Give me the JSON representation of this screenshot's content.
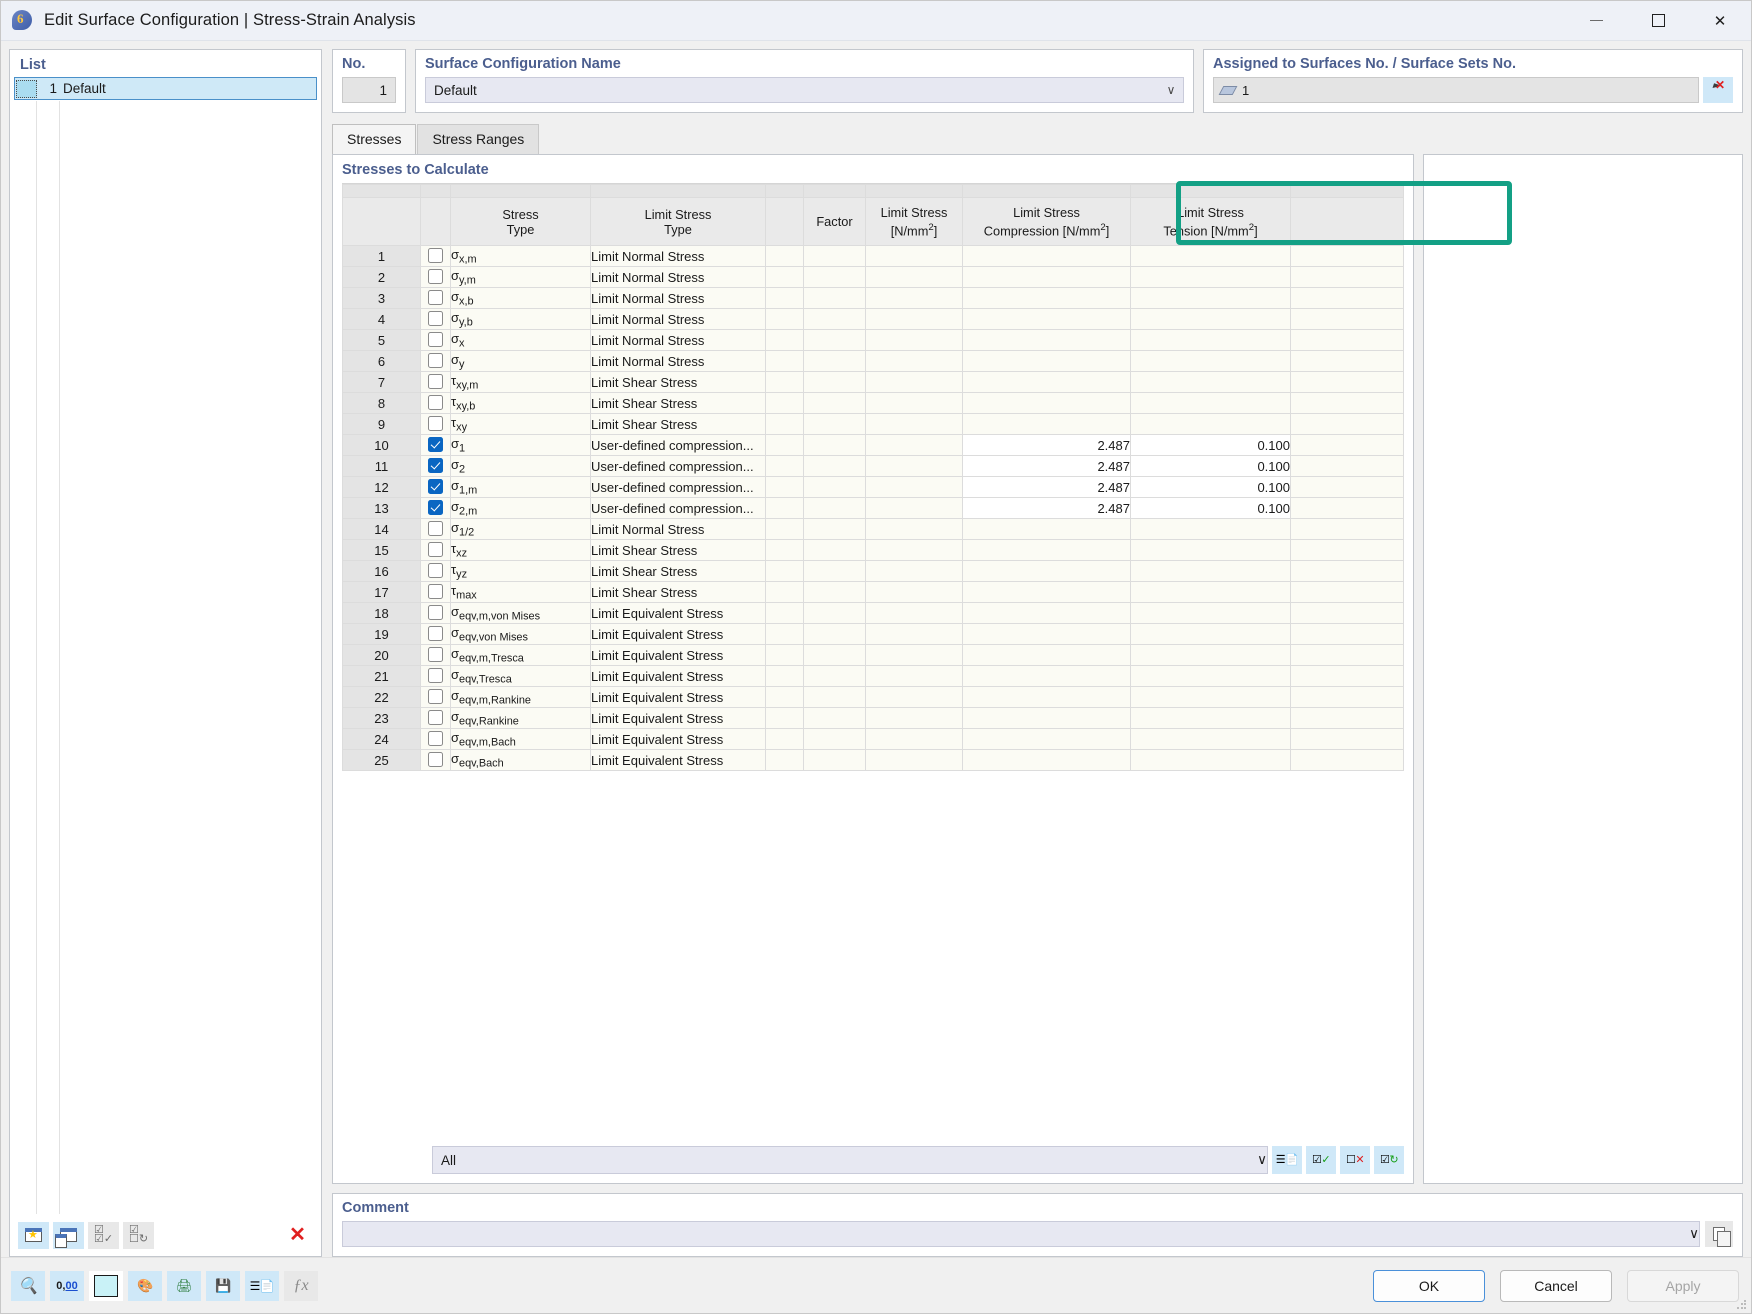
{
  "window": {
    "title": "Edit Surface Configuration | Stress-Strain Analysis",
    "icon": "rfem-surface-icon",
    "minimize": "—",
    "maximize": "□",
    "close": "✕"
  },
  "left_panel": {
    "title": "List",
    "rows": [
      {
        "index": "1",
        "name": "Default"
      }
    ],
    "toolbar": [
      {
        "name": "new-entry-button",
        "icon": "new-window-icon"
      },
      {
        "name": "copy-entry-button",
        "icon": "copy-window-icon"
      },
      {
        "name": "select-all-button",
        "icon": "check-all-icon"
      },
      {
        "name": "invert-selection-button",
        "icon": "invert-check-icon"
      },
      {
        "name": "delete-entry-button",
        "icon": "red-x-icon"
      }
    ]
  },
  "no_group": {
    "label": "No.",
    "value": "1"
  },
  "name_group": {
    "label": "Surface Configuration Name",
    "value": "Default",
    "caret": "∨"
  },
  "assigned_group": {
    "label": "Assigned to Surfaces No. / Surface Sets No.",
    "value": "1",
    "picker_icon": "select-surfaces-cursor-icon"
  },
  "tabs": [
    {
      "label": "Stresses",
      "active": true
    },
    {
      "label": "Stress Ranges",
      "active": false
    }
  ],
  "table": {
    "title": "Stresses to Calculate",
    "headers": {
      "num": "",
      "check": "",
      "stress_type_l1": "Stress",
      "stress_type_l2": "Type",
      "limit_stress_type_l1": "Limit Stress",
      "limit_stress_type_l2": "Type",
      "spacer": "",
      "factor": "Factor",
      "limit_stress_l1": "Limit Stress",
      "limit_stress_l2": "[N/mm",
      "limit_stress_sup": "2",
      "limit_stress_l2end": "]",
      "limit_compression_l1": "Limit Stress",
      "limit_compression_l2": "Compression [N/mm",
      "limit_compression_sup": "2",
      "limit_compression_l2end": "]",
      "limit_tension_l1": "Limit Stress",
      "limit_tension_l2": "Tension [N/mm",
      "limit_tension_sup": "2",
      "limit_tension_l2end": "]"
    },
    "rows": [
      {
        "no": "1",
        "checked": false,
        "sym": "σ",
        "sub": "x,m",
        "limit_type": "Limit Normal Stress",
        "factor": "",
        "limit_stress": "",
        "compression": "",
        "tension": ""
      },
      {
        "no": "2",
        "checked": false,
        "sym": "σ",
        "sub": "y,m",
        "limit_type": "Limit Normal Stress",
        "factor": "",
        "limit_stress": "",
        "compression": "",
        "tension": ""
      },
      {
        "no": "3",
        "checked": false,
        "sym": "σ",
        "sub": "x,b",
        "limit_type": "Limit Normal Stress",
        "factor": "",
        "limit_stress": "",
        "compression": "",
        "tension": ""
      },
      {
        "no": "4",
        "checked": false,
        "sym": "σ",
        "sub": "y,b",
        "limit_type": "Limit Normal Stress",
        "factor": "",
        "limit_stress": "",
        "compression": "",
        "tension": ""
      },
      {
        "no": "5",
        "checked": false,
        "sym": "σ",
        "sub": "x",
        "limit_type": "Limit Normal Stress",
        "factor": "",
        "limit_stress": "",
        "compression": "",
        "tension": ""
      },
      {
        "no": "6",
        "checked": false,
        "sym": "σ",
        "sub": "y",
        "limit_type": "Limit Normal Stress",
        "factor": "",
        "limit_stress": "",
        "compression": "",
        "tension": ""
      },
      {
        "no": "7",
        "checked": false,
        "sym": "τ",
        "sub": "xy,m",
        "limit_type": "Limit Shear Stress",
        "factor": "",
        "limit_stress": "",
        "compression": "",
        "tension": ""
      },
      {
        "no": "8",
        "checked": false,
        "sym": "τ",
        "sub": "xy,b",
        "limit_type": "Limit Shear Stress",
        "factor": "",
        "limit_stress": "",
        "compression": "",
        "tension": ""
      },
      {
        "no": "9",
        "checked": false,
        "sym": "τ",
        "sub": "xy",
        "limit_type": "Limit Shear Stress",
        "factor": "",
        "limit_stress": "",
        "compression": "",
        "tension": ""
      },
      {
        "no": "10",
        "checked": true,
        "sym": "σ",
        "sub": "1",
        "limit_type": "User-defined compression...",
        "factor": "",
        "limit_stress": "",
        "compression": "2.487",
        "tension": "0.100"
      },
      {
        "no": "11",
        "checked": true,
        "sym": "σ",
        "sub": "2",
        "limit_type": "User-defined compression...",
        "factor": "",
        "limit_stress": "",
        "compression": "2.487",
        "tension": "0.100"
      },
      {
        "no": "12",
        "checked": true,
        "sym": "σ",
        "sub": "1,m",
        "limit_type": "User-defined compression...",
        "factor": "",
        "limit_stress": "",
        "compression": "2.487",
        "tension": "0.100"
      },
      {
        "no": "13",
        "checked": true,
        "sym": "σ",
        "sub": "2,m",
        "limit_type": "User-defined compression...",
        "factor": "",
        "limit_stress": "",
        "compression": "2.487",
        "tension": "0.100"
      },
      {
        "no": "14",
        "checked": false,
        "sym": "σ",
        "sub": "1/2",
        "limit_type": "Limit Normal Stress",
        "factor": "",
        "limit_stress": "",
        "compression": "",
        "tension": ""
      },
      {
        "no": "15",
        "checked": false,
        "sym": "τ",
        "sub": "xz",
        "limit_type": "Limit Shear Stress",
        "factor": "",
        "limit_stress": "",
        "compression": "",
        "tension": ""
      },
      {
        "no": "16",
        "checked": false,
        "sym": "τ",
        "sub": "yz",
        "limit_type": "Limit Shear Stress",
        "factor": "",
        "limit_stress": "",
        "compression": "",
        "tension": ""
      },
      {
        "no": "17",
        "checked": false,
        "sym": "τ",
        "sub": "max",
        "limit_type": "Limit Shear Stress",
        "factor": "",
        "limit_stress": "",
        "compression": "",
        "tension": ""
      },
      {
        "no": "18",
        "checked": false,
        "sym": "σ",
        "sub": "eqv,m,von Mises",
        "limit_type": "Limit Equivalent Stress",
        "factor": "",
        "limit_stress": "",
        "compression": "",
        "tension": ""
      },
      {
        "no": "19",
        "checked": false,
        "sym": "σ",
        "sub": "eqv,von Mises",
        "limit_type": "Limit Equivalent Stress",
        "factor": "",
        "limit_stress": "",
        "compression": "",
        "tension": ""
      },
      {
        "no": "20",
        "checked": false,
        "sym": "σ",
        "sub": "eqv,m,Tresca",
        "limit_type": "Limit Equivalent Stress",
        "factor": "",
        "limit_stress": "",
        "compression": "",
        "tension": ""
      },
      {
        "no": "21",
        "checked": false,
        "sym": "σ",
        "sub": "eqv,Tresca",
        "limit_type": "Limit Equivalent Stress",
        "factor": "",
        "limit_stress": "",
        "compression": "",
        "tension": ""
      },
      {
        "no": "22",
        "checked": false,
        "sym": "σ",
        "sub": "eqv,m,Rankine",
        "limit_type": "Limit Equivalent Stress",
        "factor": "",
        "limit_stress": "",
        "compression": "",
        "tension": ""
      },
      {
        "no": "23",
        "checked": false,
        "sym": "σ",
        "sub": "eqv,Rankine",
        "limit_type": "Limit Equivalent Stress",
        "factor": "",
        "limit_stress": "",
        "compression": "",
        "tension": ""
      },
      {
        "no": "24",
        "checked": false,
        "sym": "σ",
        "sub": "eqv,m,Bach",
        "limit_type": "Limit Equivalent Stress",
        "factor": "",
        "limit_stress": "",
        "compression": "",
        "tension": ""
      },
      {
        "no": "25",
        "checked": false,
        "sym": "σ",
        "sub": "eqv,Bach",
        "limit_type": "Limit Equivalent Stress",
        "factor": "",
        "limit_stress": "",
        "compression": "",
        "tension": ""
      }
    ]
  },
  "highlight": {
    "color": "#13a085",
    "targets": [
      "Limit Stress Compression [N/mm2]",
      "Limit Stress Tension [N/mm2]"
    ]
  },
  "filter": {
    "value": "All",
    "caret": "∨",
    "buttons": [
      {
        "name": "database-filter-button",
        "icon": "database-icon"
      },
      {
        "name": "check-all-button",
        "icon": "check-all-green-icon"
      },
      {
        "name": "uncheck-all-button",
        "icon": "uncheck-red-x-icon"
      },
      {
        "name": "restore-defaults-button",
        "icon": "refresh-check-icon"
      }
    ]
  },
  "comment": {
    "label": "Comment",
    "value": "",
    "caret": "∨",
    "button_icon": "copy-icon"
  },
  "footer": {
    "tools": [
      {
        "name": "help-button",
        "icon": "help-magnifier-icon"
      },
      {
        "name": "decimal-places-button",
        "icon": "number-format-icon"
      },
      {
        "name": "color-swatch-button",
        "icon": "color-swatch-icon"
      },
      {
        "name": "font-settings-button",
        "icon": "font-color-icon"
      },
      {
        "name": "print-button",
        "icon": "printer-icon"
      },
      {
        "name": "save-button",
        "icon": "save-disk-icon"
      },
      {
        "name": "database-button",
        "icon": "database-export-icon"
      },
      {
        "name": "formula-button",
        "icon": "formula-fx-icon"
      }
    ],
    "ok": "OK",
    "cancel": "Cancel",
    "apply": "Apply"
  }
}
